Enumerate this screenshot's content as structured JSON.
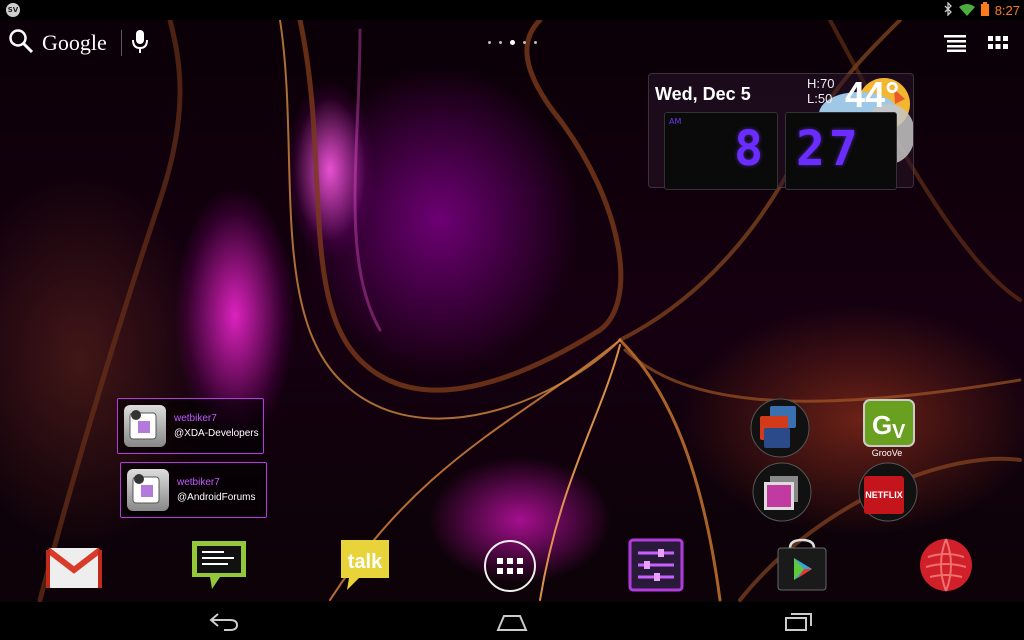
{
  "status_bar": {
    "notification_icon": "sv-badge-icon",
    "notification_text": "SV",
    "time": "8:27",
    "icons": [
      "bluetooth-icon",
      "wifi-icon",
      "battery-icon"
    ]
  },
  "search": {
    "label": "Google",
    "icons": [
      "search-icon",
      "mic-icon"
    ]
  },
  "home_pages": {
    "count": 5,
    "active_index": 2
  },
  "top_right_icons": [
    "list-icon",
    "apps-grid-icon"
  ],
  "weather_widget": {
    "date": "Wed, Dec 5",
    "high": "H:70",
    "low": "L:50",
    "temperature": "44°",
    "am_pm": "AM",
    "hour": "8",
    "minute": "27"
  },
  "favorites": [
    {
      "user": "wetbiker7",
      "handle": "@XDA-Developers"
    },
    {
      "user": "wetbiker7",
      "handle": "@AndroidForums"
    }
  ],
  "home_apps": {
    "games_folder": "folder-icon",
    "gallery": "gallery-icon",
    "groove": "GrooVe",
    "netflix": "NETFLIX"
  },
  "dock": {
    "talk_label": "talk",
    "apps": [
      "gmail-icon",
      "messaging-icon",
      "talk-icon",
      "all-apps-icon",
      "settings-icon",
      "play-store-icon",
      "browser-icon"
    ]
  },
  "colors": {
    "accent": "#b33adf",
    "clock": "#6a2cff",
    "status_time": "#ff7a1a"
  }
}
